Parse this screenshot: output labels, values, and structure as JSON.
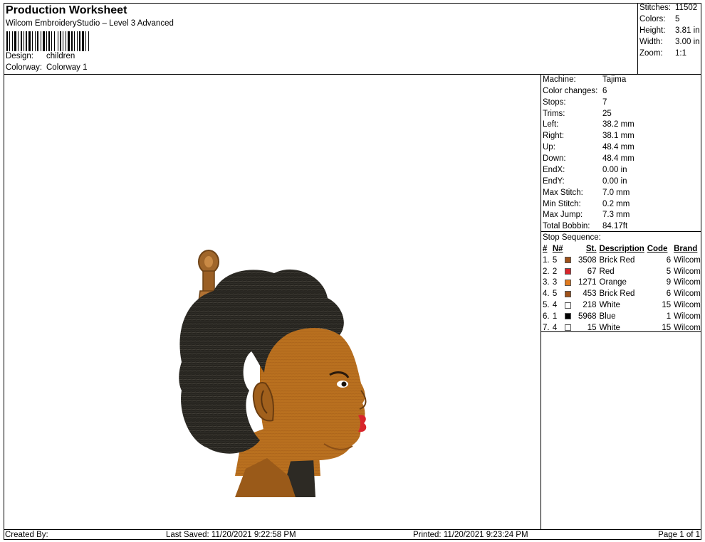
{
  "header": {
    "title": "Production Worksheet",
    "subtitle": "Wilcom EmbroideryStudio – Level 3 Advanced",
    "design_label": "Design:",
    "design_value": "children",
    "colorway_label": "Colorway:",
    "colorway_value": "Colorway 1"
  },
  "stats": [
    {
      "label": "Stitches:",
      "value": "11502"
    },
    {
      "label": "Colors:",
      "value": "5"
    },
    {
      "label": "Height:",
      "value": "3.81 in"
    },
    {
      "label": "Width:",
      "value": "3.00 in"
    },
    {
      "label": "Zoom:",
      "value": "1:1"
    }
  ],
  "machine_info": [
    {
      "label": "Machine:",
      "value": "Tajima"
    },
    {
      "label": "Color changes:",
      "value": "6"
    },
    {
      "label": "Stops:",
      "value": "7"
    },
    {
      "label": "Trims:",
      "value": "25"
    },
    {
      "label": "Left:",
      "value": "38.2 mm"
    },
    {
      "label": "Right:",
      "value": "38.1 mm"
    },
    {
      "label": "Up:",
      "value": "48.4 mm"
    },
    {
      "label": "Down:",
      "value": "48.4 mm"
    },
    {
      "label": "EndX:",
      "value": "0.00 in"
    },
    {
      "label": "EndY:",
      "value": "0.00 in"
    },
    {
      "label": "Max Stitch:",
      "value": "7.0 mm"
    },
    {
      "label": "Min Stitch:",
      "value": "0.2 mm"
    },
    {
      "label": "Max Jump:",
      "value": "7.3 mm"
    },
    {
      "label": "Total Bobbin:",
      "value": "84.17ft"
    }
  ],
  "stop_sequence": {
    "title": "Stop Sequence:",
    "columns": [
      "#",
      "N#",
      "St.",
      "Description",
      "Code",
      "Brand"
    ],
    "rows": [
      {
        "num": "1.",
        "n": "5",
        "color": "#a0521a",
        "stitches": "3508",
        "description": "Brick Red",
        "code": "6",
        "brand": "Wilcom"
      },
      {
        "num": "2.",
        "n": "2",
        "color": "#d8252b",
        "stitches": "67",
        "description": "Red",
        "code": "5",
        "brand": "Wilcom"
      },
      {
        "num": "3.",
        "n": "3",
        "color": "#e07a1e",
        "stitches": "1271",
        "description": "Orange",
        "code": "9",
        "brand": "Wilcom"
      },
      {
        "num": "4.",
        "n": "5",
        "color": "#a0521a",
        "stitches": "453",
        "description": "Brick Red",
        "code": "6",
        "brand": "Wilcom"
      },
      {
        "num": "5.",
        "n": "4",
        "color": "#ffffff",
        "stitches": "218",
        "description": "White",
        "code": "15",
        "brand": "Wilcom"
      },
      {
        "num": "6.",
        "n": "1",
        "color": "#000000",
        "stitches": "5968",
        "description": "Blue",
        "code": "1",
        "brand": "Wilcom"
      },
      {
        "num": "7.",
        "n": "4",
        "color": "#ffffff",
        "stitches": "15",
        "description": "White",
        "code": "15",
        "brand": "Wilcom"
      }
    ]
  },
  "footer": {
    "created_by": "Created By:",
    "last_saved": "Last Saved: 11/20/2021 9:22:58 PM",
    "printed": "Printed: 11/20/2021 9:23:24 PM",
    "page": "Page 1 of 1"
  }
}
